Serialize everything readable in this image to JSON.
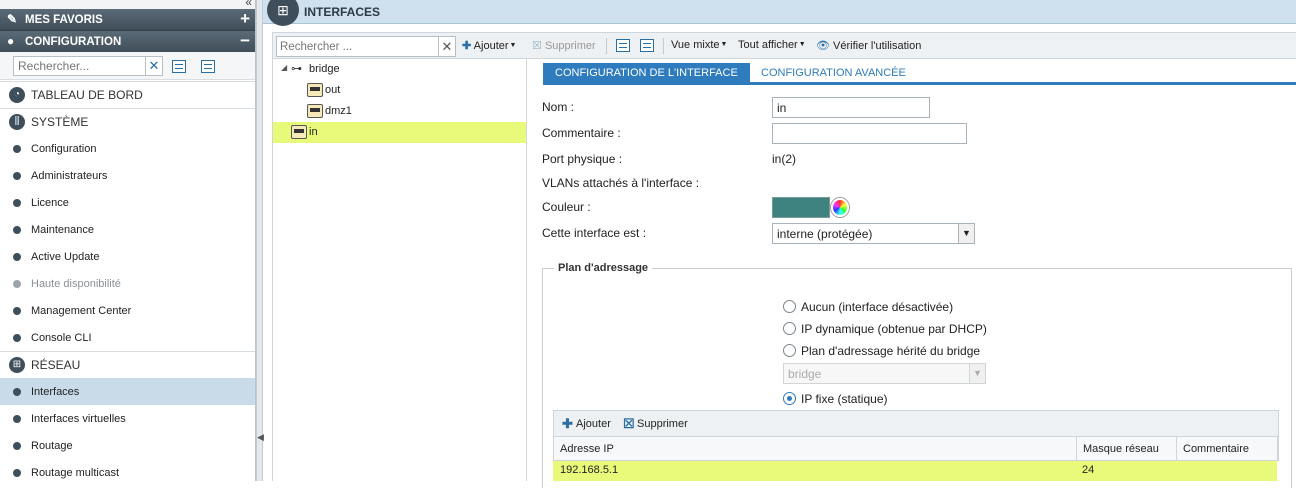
{
  "sidebar": {
    "favorites_label": "MES FAVORIS",
    "configuration_label": "CONFIGURATION",
    "search_placeholder": "Rechercher...",
    "categories": {
      "dashboard": "TABLEAU DE BORD",
      "system": "SYSTÈME",
      "network": "RÉSEAU"
    },
    "system_items": [
      {
        "label": "Configuration"
      },
      {
        "label": "Administrateurs"
      },
      {
        "label": "Licence"
      },
      {
        "label": "Maintenance"
      },
      {
        "label": "Active Update"
      },
      {
        "label": "Haute disponibilité",
        "disabled": true
      },
      {
        "label": "Management Center"
      },
      {
        "label": "Console CLI"
      }
    ],
    "network_items": [
      {
        "label": "Interfaces",
        "selected": true
      },
      {
        "label": "Interfaces virtuelles"
      },
      {
        "label": "Routage"
      },
      {
        "label": "Routage multicast"
      }
    ]
  },
  "header": {
    "title": "INTERFACES"
  },
  "toolbar": {
    "search_placeholder": "Rechercher ...",
    "add": "Ajouter",
    "delete": "Supprimer",
    "view_mode": "Vue mixte",
    "show_all": "Tout afficher",
    "check_usage": "Vérifier l'utilisation"
  },
  "tree": {
    "root": "bridge",
    "children": [
      "out",
      "dmz1"
    ],
    "selected": "in"
  },
  "tabs": {
    "interface_config": "CONFIGURATION DE L'INTERFACE",
    "advanced_config": "CONFIGURATION AVANCÉE"
  },
  "form": {
    "name_label": "Nom :",
    "name_value": "in",
    "comment_label": "Commentaire :",
    "comment_value": "",
    "port_label": "Port physique :",
    "port_value": "in(2)",
    "vlans_label": "VLANs attachés à l'interface :",
    "color_label": "Couleur :",
    "color_value": "#3f8380",
    "type_label": "Cette interface est :",
    "type_value": "interne (protégée)"
  },
  "addressing": {
    "legend": "Plan d'adressage",
    "options": {
      "none": "Aucun (interface désactivée)",
      "dhcp": "IP dynamique (obtenue par DHCP)",
      "bridge": "Plan d'adressage hérité du bridge",
      "static": "IP fixe (statique)"
    },
    "selected": "static",
    "bridge_select": "bridge",
    "grid": {
      "add": "Ajouter",
      "delete": "Supprimer",
      "columns": [
        "Adresse IP",
        "Masque réseau",
        "Commentaire"
      ],
      "rows": [
        {
          "ip": "192.168.5.1",
          "mask": "24",
          "comment": ""
        }
      ]
    }
  }
}
